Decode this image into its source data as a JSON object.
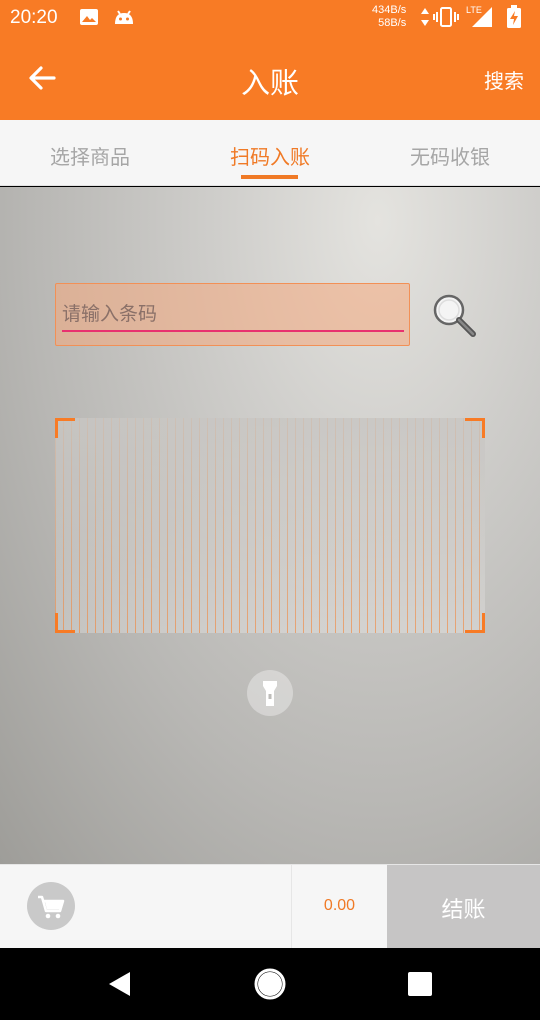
{
  "status_bar": {
    "time": "20:20",
    "net_speed_up": "434B/s",
    "net_speed_down": "58B/s",
    "network_label": "LTE",
    "icons": [
      "image-icon",
      "android-bot-icon",
      "vibrate-icon",
      "signal-icon",
      "battery-charging-icon"
    ]
  },
  "app_bar": {
    "title": "入账",
    "search_label": "搜索",
    "back_icon": "arrow-left-icon"
  },
  "tabs": [
    {
      "label": "选择商品",
      "active": false
    },
    {
      "label": "扫码入账",
      "active": true
    },
    {
      "label": "无码收银",
      "active": false
    }
  ],
  "scanner": {
    "barcode_placeholder": "请输入条码",
    "barcode_value": "",
    "search_icon": "magnifier-icon",
    "flashlight_icon": "flashlight-icon"
  },
  "bottom_bar": {
    "cart_icon": "cart-icon",
    "total": "0.00",
    "checkout_label": "结账"
  },
  "colors": {
    "brand": "#f87b25",
    "tab_active": "#f07a26",
    "tab_inactive": "#a6a6a6",
    "input_underline": "#e8316f",
    "checkout_bg": "#c6c5c5"
  }
}
